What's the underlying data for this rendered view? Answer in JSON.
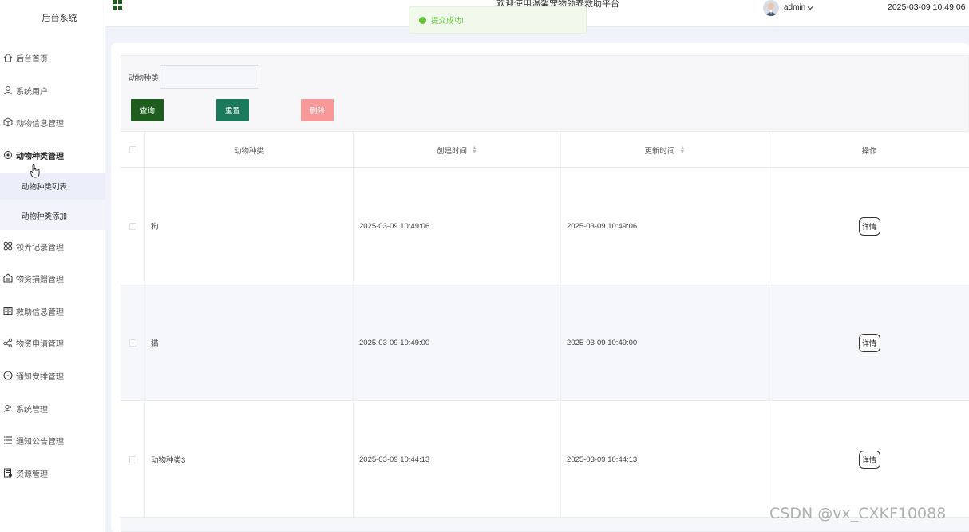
{
  "sidebar": {
    "brand": "后台系统",
    "items": [
      {
        "label": "后台首页",
        "icon": "home-icon"
      },
      {
        "label": "系统用户",
        "icon": "user-icon"
      },
      {
        "label": "动物信息管理",
        "icon": "cube-icon"
      },
      {
        "label": "动物种类管理",
        "icon": "target-icon"
      },
      {
        "label": "领养记录管理",
        "icon": "grid-circles-icon"
      },
      {
        "label": "物资捐赠管理",
        "icon": "house-icon"
      },
      {
        "label": "救助信息管理",
        "icon": "book-icon"
      },
      {
        "label": "物资申请管理",
        "icon": "share-icon"
      },
      {
        "label": "通知安排管理",
        "icon": "chat-icon"
      },
      {
        "label": "系统管理",
        "icon": "users-icon"
      },
      {
        "label": "通知公告管理",
        "icon": "list-icon"
      },
      {
        "label": "资源管理",
        "icon": "document-icon"
      }
    ],
    "submenu": [
      {
        "label": "动物种类列表"
      },
      {
        "label": "动物种类添加"
      }
    ]
  },
  "header": {
    "title": "欢迎使用温馨宠物领养救助平台",
    "username": "admin",
    "datetime": "2025-03-09 10:49:06"
  },
  "toast": {
    "message": "提交成功!",
    "color": "#67c23a"
  },
  "search": {
    "label": "动物种类",
    "value": "",
    "query_label": "查询",
    "reset_label": "重置",
    "delete_label": "删除"
  },
  "table": {
    "columns": [
      "动物种类",
      "创建时间",
      "更新时间",
      "操作"
    ],
    "rows": [
      {
        "type": "狗",
        "created": "2025-03-09 10:49:06",
        "updated": "2025-03-09 10:49:06",
        "action": "详情"
      },
      {
        "type": "猫",
        "created": "2025-03-09 10:49:00",
        "updated": "2025-03-09 10:49:00",
        "action": "详情"
      },
      {
        "type": "动物种类3",
        "created": "2025-03-09 10:44:13",
        "updated": "2025-03-09 10:44:13",
        "action": "详情"
      }
    ]
  },
  "watermark": "CSDN @vx_CXKF10088",
  "colors": {
    "query": "#1f5d1f",
    "reset": "#1b7a5b",
    "delete": "#f89898"
  }
}
